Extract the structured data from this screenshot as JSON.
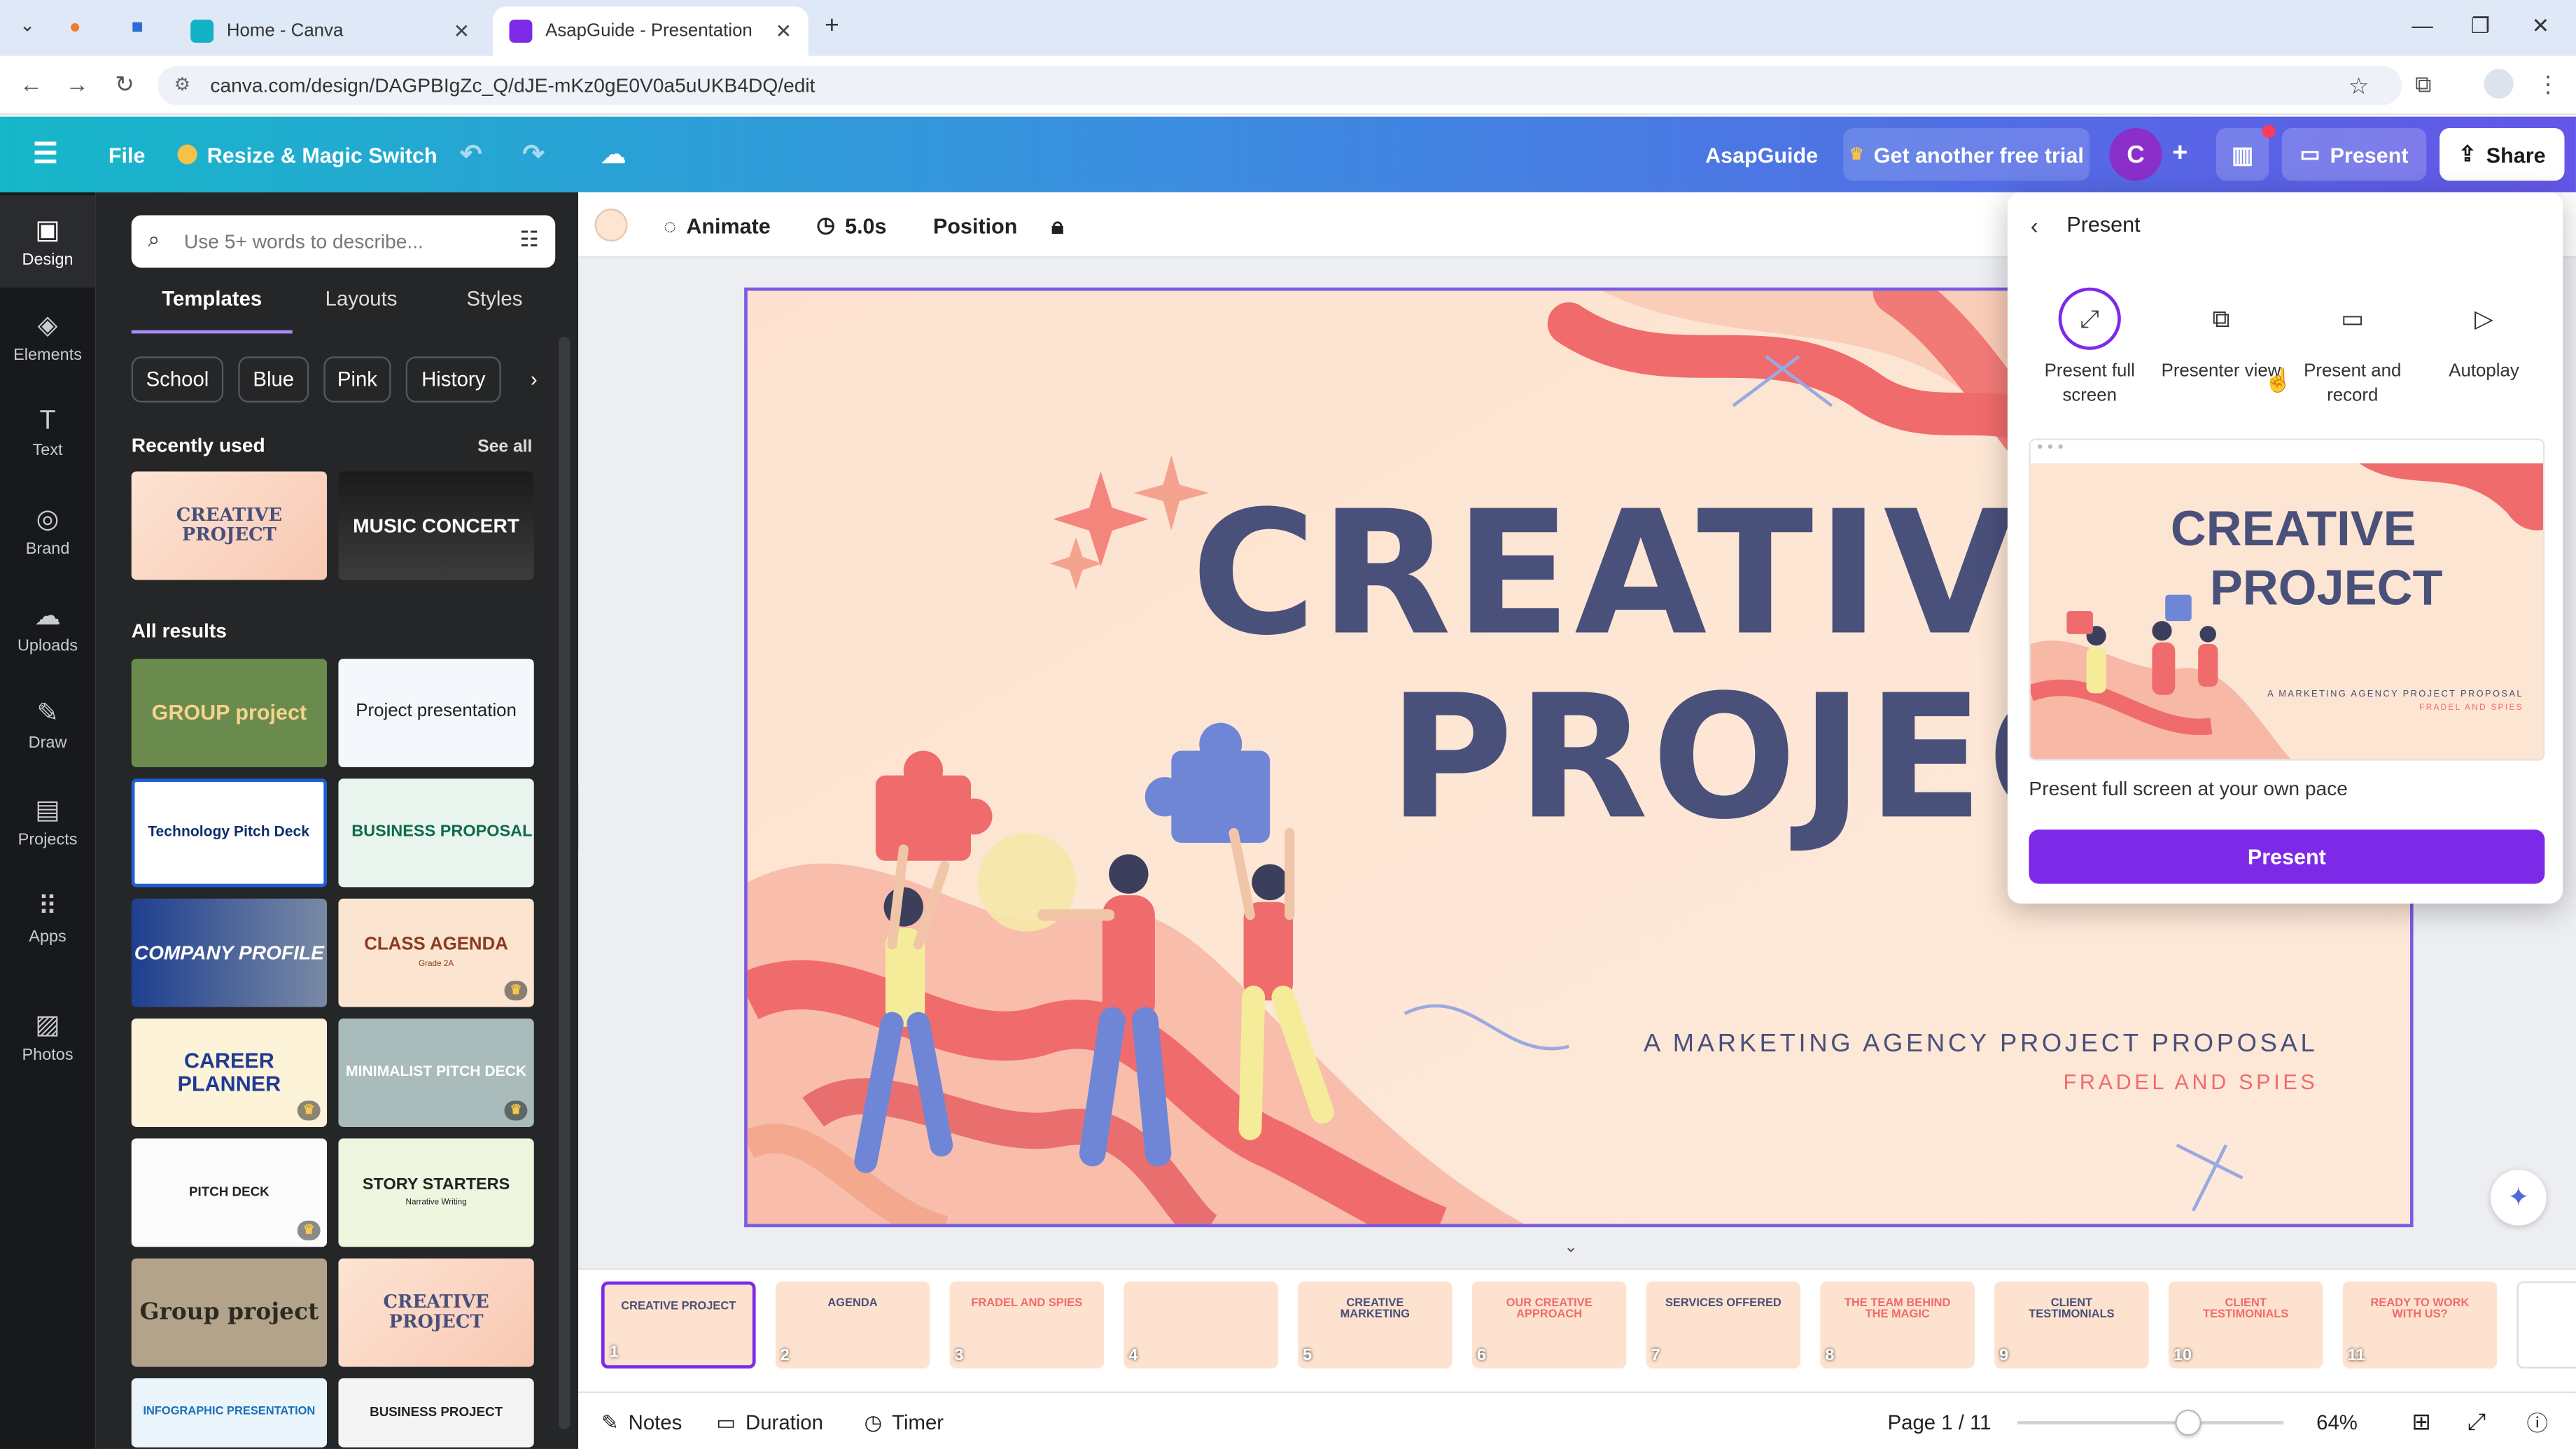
{
  "browser": {
    "tabs": [
      {
        "label": "Home - Canva"
      },
      {
        "label": "AsapGuide - Presentation"
      }
    ],
    "url": "canva.com/design/DAGPBIgZc_Q/dJE-mKz0gE0V0a5uUKB4DQ/edit"
  },
  "header": {
    "menu_label": "File",
    "resize_label": "Resize & Magic Switch",
    "doc_title": "AsapGuide",
    "trial_label": "Get another free trial",
    "avatar_letter": "C",
    "present_label": "Present",
    "share_label": "Share"
  },
  "rail": [
    {
      "label": "Design",
      "icon": "design-icon"
    },
    {
      "label": "Elements",
      "icon": "elements-icon"
    },
    {
      "label": "Text",
      "icon": "text-icon"
    },
    {
      "label": "Brand",
      "icon": "brand-icon"
    },
    {
      "label": "Uploads",
      "icon": "uploads-icon"
    },
    {
      "label": "Draw",
      "icon": "draw-icon"
    },
    {
      "label": "Projects",
      "icon": "projects-icon"
    },
    {
      "label": "Apps",
      "icon": "apps-icon"
    },
    {
      "label": "Photos",
      "icon": "photos-icon"
    }
  ],
  "panel": {
    "search_placeholder": "Use 5+ words to describe...",
    "tabs": [
      "Templates",
      "Layouts",
      "Styles"
    ],
    "chips": [
      "School",
      "Blue",
      "Pink",
      "History"
    ],
    "recent_title": "Recently used",
    "see_all": "See all",
    "all_results_title": "All results",
    "recent": [
      {
        "title": "CREATIVE PROJECT",
        "sub": ""
      },
      {
        "title": "MUSIC CONCERT",
        "sub": ""
      }
    ],
    "results": [
      {
        "title": "GROUP project",
        "sub": ""
      },
      {
        "title": "Project presentation",
        "sub": ""
      },
      {
        "title": "Technology Pitch Deck",
        "sub": ""
      },
      {
        "title": "BUSINESS PROPOSAL",
        "sub": ""
      },
      {
        "title": "COMPANY PROFILE",
        "sub": ""
      },
      {
        "title": "CLASS AGENDA",
        "sub": "Grade 2A"
      },
      {
        "title": "CAREER PLANNER",
        "sub": ""
      },
      {
        "title": "MINIMALIST PITCH DECK",
        "sub": ""
      },
      {
        "title": "PITCH DECK",
        "sub": ""
      },
      {
        "title": "STORY STARTERS",
        "sub": "Narrative Writing"
      },
      {
        "title": "Group project",
        "sub": ""
      },
      {
        "title": "CREATIVE PROJECT",
        "sub": ""
      },
      {
        "title": "INFOGRAPHIC PRESENTATION",
        "sub": ""
      },
      {
        "title": "BUSINESS PROJECT",
        "sub": ""
      }
    ]
  },
  "toolbar": {
    "animate": "Animate",
    "duration": "5.0s",
    "position": "Position"
  },
  "slide": {
    "title_line1": "CREATIVE",
    "title_line2": "PROJECT",
    "subtitle": "A MARKETING AGENCY PROJECT PROPOSAL",
    "byline": "FRADEL AND SPIES"
  },
  "present_panel": {
    "title": "Present",
    "options": [
      {
        "label": "Present full screen",
        "icon": "expand-icon"
      },
      {
        "label": "Presenter view",
        "icon": "presenter-view-icon"
      },
      {
        "label": "Present and record",
        "icon": "record-icon"
      },
      {
        "label": "Autoplay",
        "icon": "play-icon"
      }
    ],
    "description": "Present full screen at your own pace",
    "button": "Present"
  },
  "filmstrip": [
    {
      "num": "1",
      "label": "CREATIVE PROJECT"
    },
    {
      "num": "2",
      "label": "AGENDA"
    },
    {
      "num": "3",
      "label": "FRADEL AND SPIES"
    },
    {
      "num": "4",
      "label": ""
    },
    {
      "num": "5",
      "label": "CREATIVE MARKETING"
    },
    {
      "num": "6",
      "label": "OUR CREATIVE APPROACH"
    },
    {
      "num": "7",
      "label": "SERVICES OFFERED"
    },
    {
      "num": "8",
      "label": "THE TEAM BEHIND THE MAGIC"
    },
    {
      "num": "9",
      "label": "CLIENT TESTIMONIALS"
    },
    {
      "num": "10",
      "label": "CLIENT TESTIMONIALS"
    },
    {
      "num": "11",
      "label": "READY TO WORK WITH US?"
    }
  ],
  "bottombar": {
    "notes": "Notes",
    "duration": "Duration",
    "timer": "Timer",
    "page": "Page 1 / 11",
    "zoom": "64%",
    "zoom_level": 0.64
  },
  "colors": {
    "accent": "#7d2ae8",
    "slide_title": "#49507a",
    "slide_accent": "#f06b6b",
    "panel_bg": "#252627",
    "rail_bg": "#18191b"
  }
}
